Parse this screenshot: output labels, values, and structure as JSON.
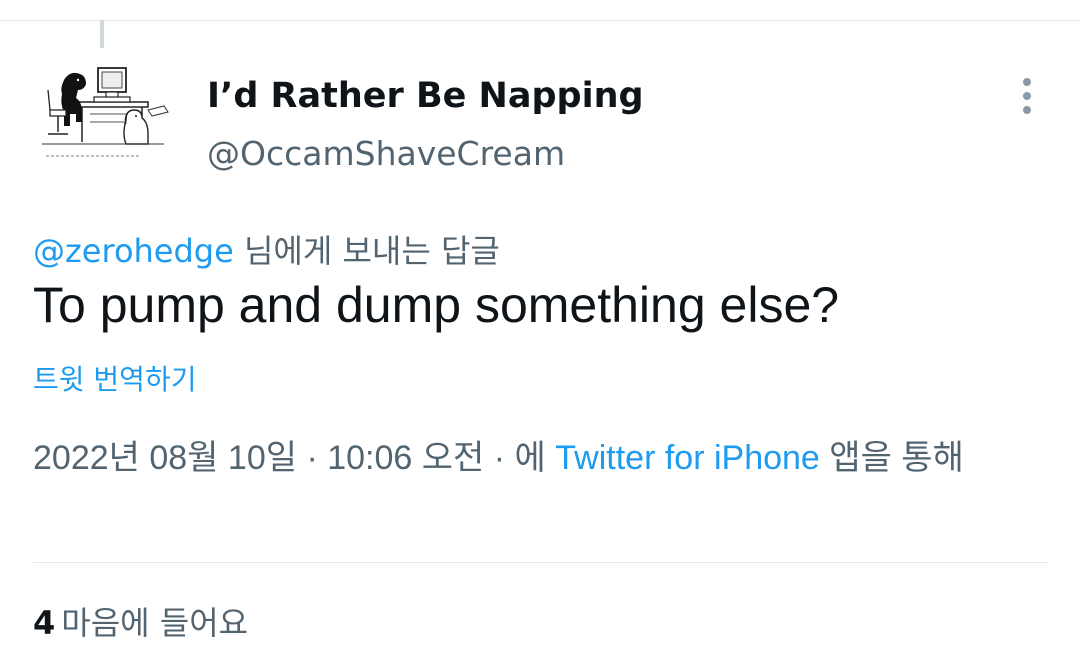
{
  "author": {
    "display_name": "I’d Rather Be Napping",
    "handle": "@OccamShaveCream"
  },
  "reply_to": {
    "mention": "@zerohedge",
    "suffix": " 님에게 보내는 답글"
  },
  "tweet": {
    "text": "To pump and dump something else?",
    "translate_label": "트윗 번역하기"
  },
  "meta": {
    "date": "2022년 08월 10일",
    "separator1": " · ",
    "time": "10:06 오전",
    "separator2": " · 에 ",
    "source": "Twitter for iPhone",
    "suffix": " 앱을 통해"
  },
  "stats": {
    "likes_count": "4",
    "likes_label": "마음에 들어요"
  },
  "icons": {
    "more": "more-vertical-icon",
    "avatar": "dog-at-computer-cartoon"
  },
  "colors": {
    "link": "#1d9bf0",
    "secondary_text": "#536471",
    "primary_text": "#0f1419",
    "divider": "#e5e8ea"
  }
}
